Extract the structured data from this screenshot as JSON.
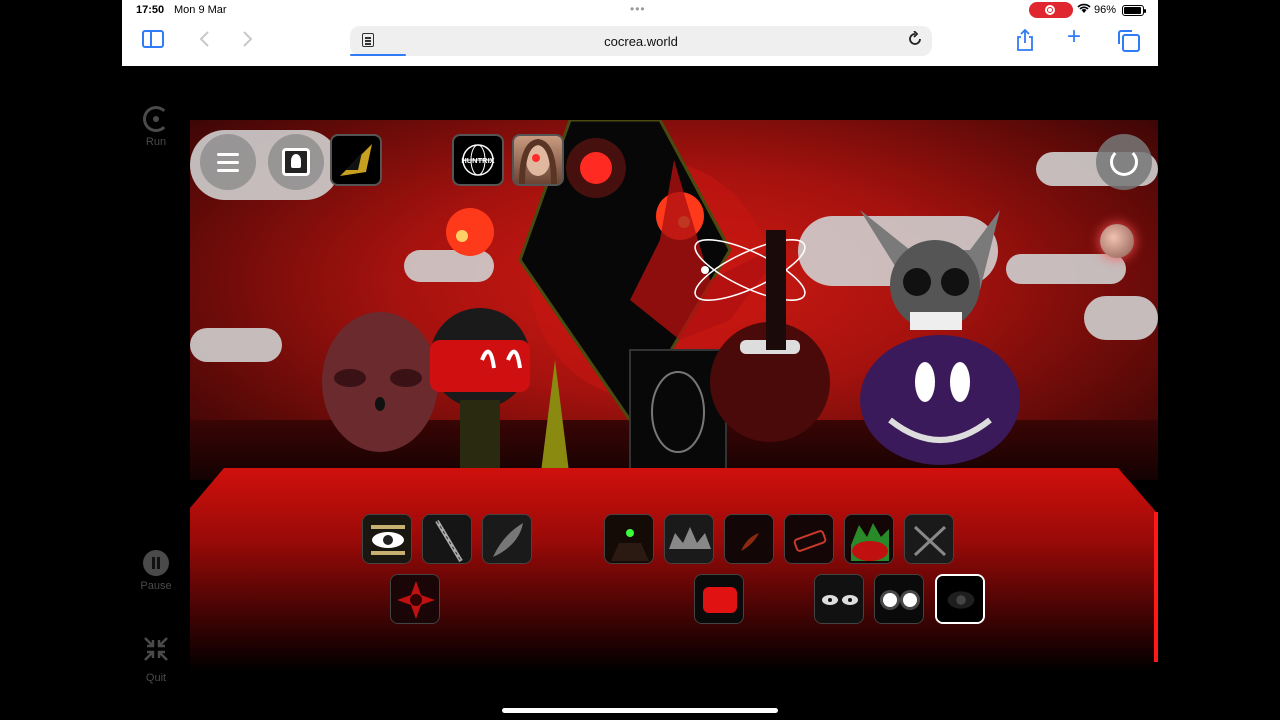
{
  "status_bar": {
    "time": "17:50",
    "date": "Mon 9 Mar",
    "battery": "96%",
    "battery_level": 0.96,
    "dots": "•••"
  },
  "browser": {
    "url": "cocrea.world",
    "back_icon": "chevron-left-icon",
    "forward_icon": "chevron-right-icon",
    "reload_icon": "reload-icon"
  },
  "side_controls": {
    "run_label": "Run",
    "pause_label": "Pause",
    "quit_label": "Quit"
  },
  "game": {
    "top_bar": {
      "menu_icon": "hamburger-icon",
      "profile_icon": "profile-frame-icon",
      "huntrix_label": "HUNTRIX",
      "reset_icon": "reset-icon",
      "orb_icon": "orb-icon"
    },
    "sound_icons_row1": [
      {
        "name": "eye-icon"
      },
      {
        "name": "blade-icon"
      },
      {
        "name": "feather-icon"
      },
      {
        "name": "green-dot-creature-icon"
      },
      {
        "name": "spikes-icon"
      },
      {
        "name": "horn-icon"
      },
      {
        "name": "tag-icon"
      },
      {
        "name": "green-red-monster-icon"
      },
      {
        "name": "cross-icon"
      }
    ],
    "sound_icons_row2": [
      {
        "name": "red-burst-icon"
      },
      {
        "name": "red-blob-icon"
      },
      {
        "name": "eyes-pair-icon"
      },
      {
        "name": "glowing-eyes-icon"
      },
      {
        "name": "dark-eye-icon"
      }
    ],
    "colors": {
      "accent_red": "#d0100c",
      "panel_edge": "#ff1a1a"
    }
  }
}
